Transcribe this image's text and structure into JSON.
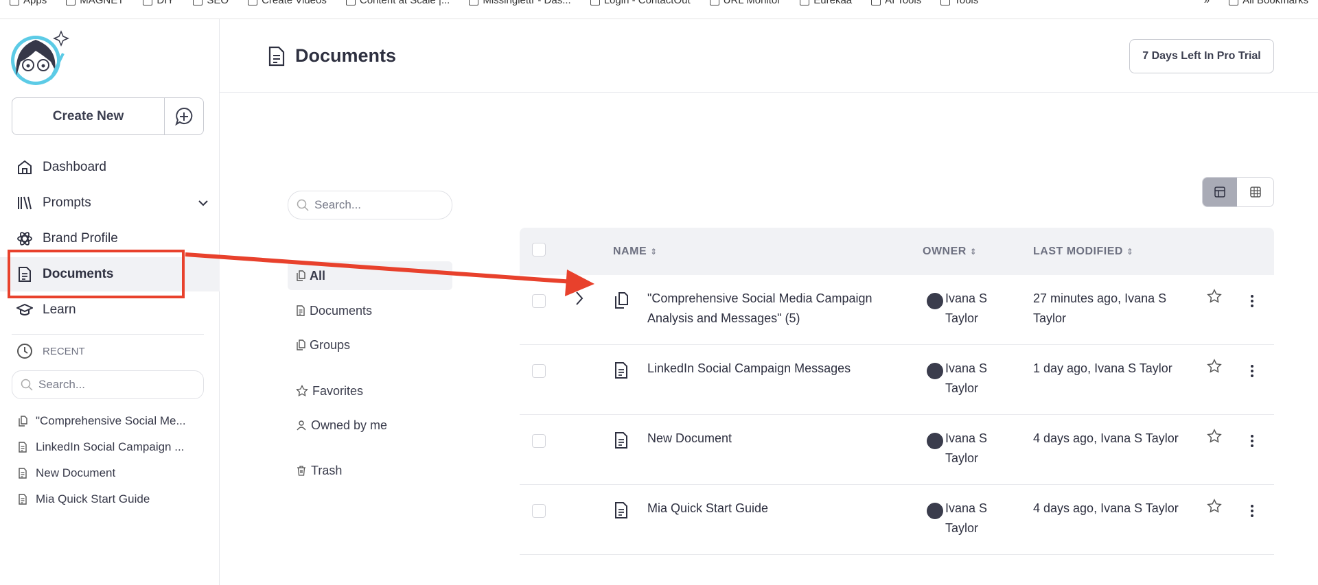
{
  "bookmarks": [
    "Apps",
    "MAGNET",
    "DIY",
    "SEO",
    "Create Videos",
    "Content at Scale |...",
    "Missinglettr - Das...",
    "Login - ContactOut",
    "URL Monitor",
    "Eurekaa",
    "AI Tools",
    "Tools",
    "»",
    "All Bookmarks"
  ],
  "sidebar": {
    "create_new": "Create New",
    "nav": [
      {
        "label": "Dashboard",
        "icon": "home-icon"
      },
      {
        "label": "Prompts",
        "icon": "library-icon"
      },
      {
        "label": "Brand Profile",
        "icon": "atom-icon"
      },
      {
        "label": "Documents",
        "icon": "document-icon"
      },
      {
        "label": "Learn",
        "icon": "graduation-cap-icon"
      }
    ],
    "recent_label": "RECENT",
    "search_placeholder": "Search...",
    "recent": [
      "\"Comprehensive Social Me...",
      "LinkedIn Social Campaign ...",
      "New Document",
      "Mia Quick Start Guide"
    ]
  },
  "header": {
    "title": "Documents",
    "trial": "7 Days Left In Pro Trial"
  },
  "filters": {
    "search_placeholder": "Search...",
    "items": [
      "All",
      "Documents",
      "Groups",
      "Favorites",
      "Owned by me",
      "Trash"
    ]
  },
  "table": {
    "columns": [
      "NAME",
      "OWNER",
      "LAST MODIFIED"
    ],
    "rows": [
      {
        "name": "\"Comprehensive Social Media Campaign Analysis and Messages\" (5)",
        "owner": "Ivana S Taylor",
        "modified": "27 minutes ago, Ivana S Taylor",
        "group": true
      },
      {
        "name": "LinkedIn Social Campaign Messages",
        "owner": "Ivana S Taylor",
        "modified": "1 day ago, Ivana S Taylor",
        "group": false
      },
      {
        "name": "New Document",
        "owner": "Ivana S Taylor",
        "modified": "4 days ago, Ivana S Taylor",
        "group": false
      },
      {
        "name": "Mia Quick Start Guide",
        "owner": "Ivana S Taylor",
        "modified": "4 days ago, Ivana S Taylor",
        "group": false
      }
    ]
  },
  "colors": {
    "annotation": "#e8412c",
    "active_bg": "#f1f2f5",
    "text": "#2e3040"
  }
}
